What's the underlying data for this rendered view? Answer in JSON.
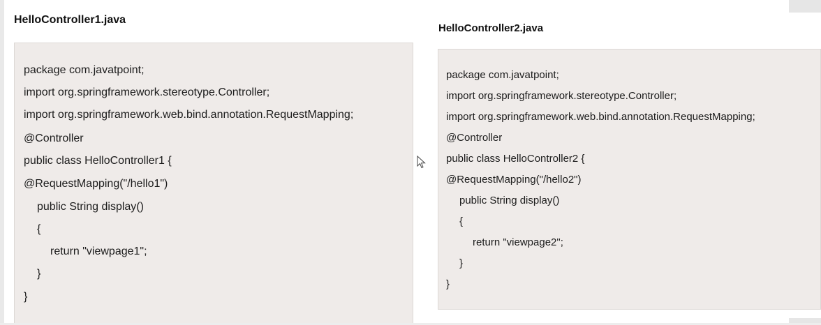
{
  "panel1": {
    "title": "HelloController1.java",
    "code": [
      "package com.javatpoint;",
      "import org.springframework.stereotype.Controller;",
      "import org.springframework.web.bind.annotation.RequestMapping;",
      "@Controller",
      "public class HelloController1 {",
      "@RequestMapping(\"/hello1\")",
      "public String display()",
      "{",
      "return \"viewpage1\";",
      "}",
      "}"
    ]
  },
  "panel2": {
    "title": "HelloController2.java",
    "code": [
      "package com.javatpoint;",
      "import org.springframework.stereotype.Controller;",
      "import org.springframework.web.bind.annotation.RequestMapping;",
      "@Controller",
      "public class HelloController2 {",
      "@RequestMapping(\"/hello2\")",
      "public String display()",
      "{",
      "return \"viewpage2\";",
      "}",
      "}"
    ]
  },
  "cursor": {
    "icon": "mouse-pointer-icon"
  }
}
